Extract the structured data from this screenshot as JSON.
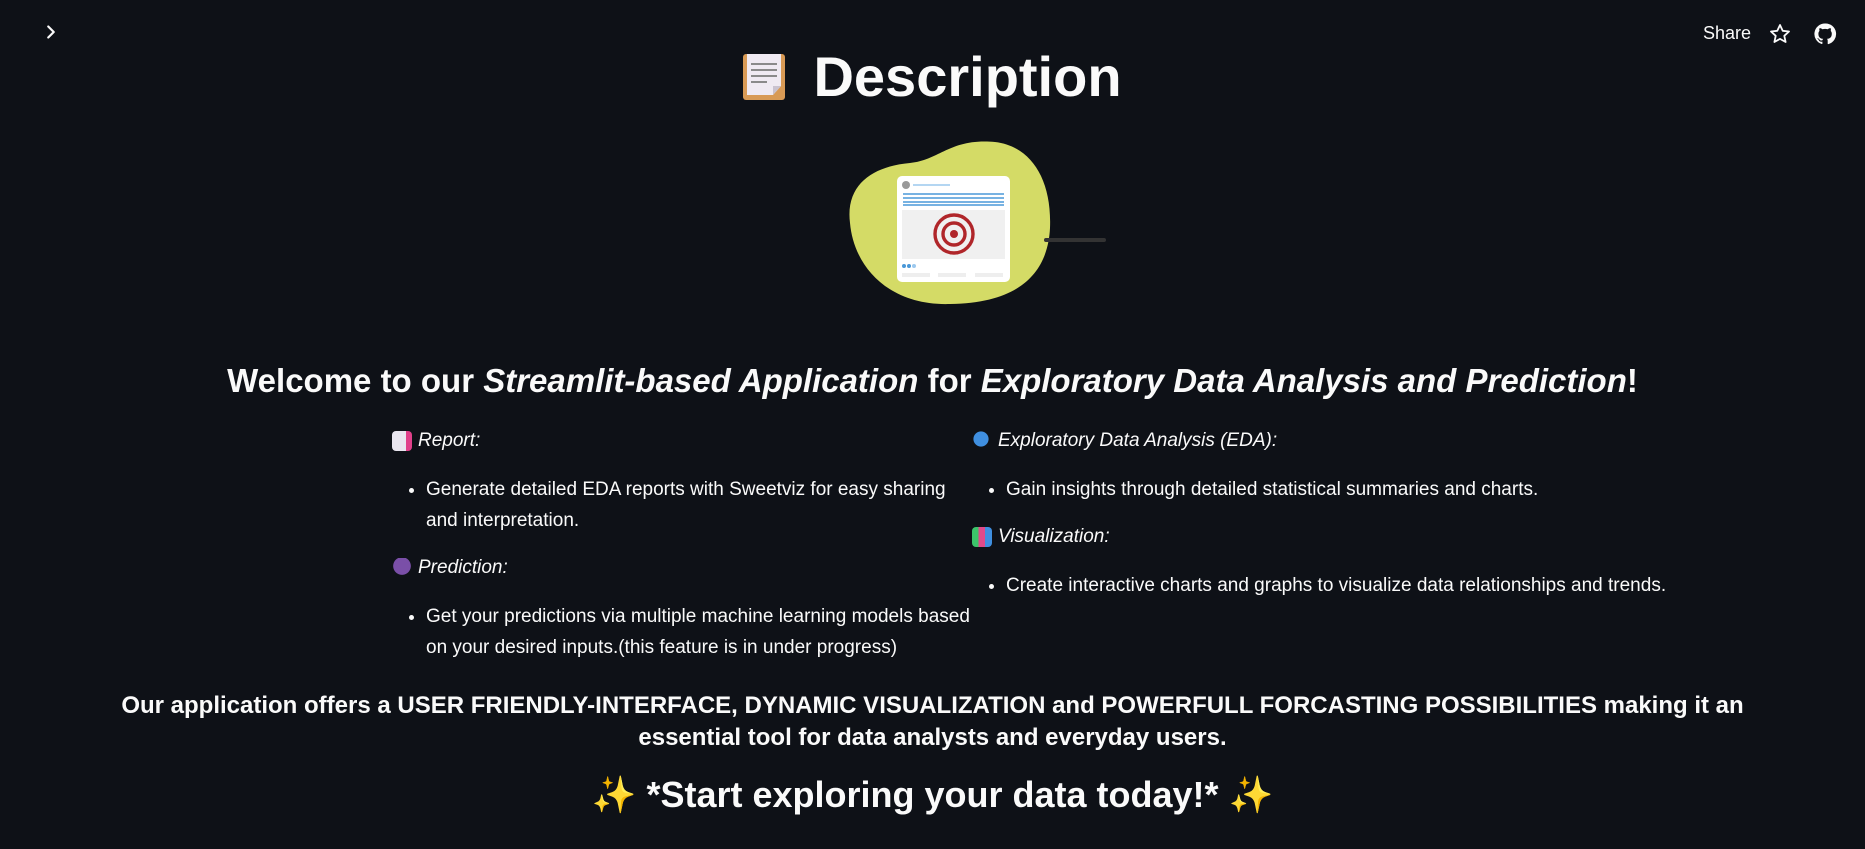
{
  "header": {
    "share_label": "Share",
    "icons": [
      "chevron-right-icon",
      "star-icon",
      "github-icon"
    ]
  },
  "page": {
    "title": "Description",
    "title_icon": "clipboard-page-icon",
    "hero_image": "target-dashboard-illustration",
    "welcome": {
      "prefix": "Welcome to our ",
      "em1": "Streamlit-based Application",
      "mid": " for ",
      "em2": "Exploratory Data Analysis and Prediction",
      "suffix": "!"
    },
    "sections": {
      "report": {
        "icon": "memo-icon",
        "heading": "Report:",
        "bullet": "Generate detailed EDA reports with Sweetviz for easy sharing and interpretation."
      },
      "prediction": {
        "icon": "crystal-ball-icon",
        "heading": "Prediction:",
        "bullet": "Get your predictions via multiple machine learning models based on your desired inputs.(this feature is in under progress)"
      },
      "eda": {
        "icon": "magnifier-icon",
        "heading": "Exploratory Data Analysis (EDA):",
        "bullet": "Gain insights through detailed statistical summaries and charts."
      },
      "visualization": {
        "icon": "bar-chart-icon",
        "heading": "Visualization:",
        "bullet": "Create interactive charts and graphs to visualize data relationships and trends."
      }
    },
    "offer": "Our application offers a USER FRIENDLY-INTERFACE, DYNAMIC VISUALIZATION and POWERFULL FORCASTING POSSIBILITIES making it an essential tool for data analysts and everyday users.",
    "cta": {
      "spark": "✨",
      "text": "*Start exploring your data today!*"
    }
  },
  "colors": {
    "background": "#0e1117",
    "text": "#fafafa",
    "blob": "#d4db66",
    "target": "#b0262a"
  }
}
